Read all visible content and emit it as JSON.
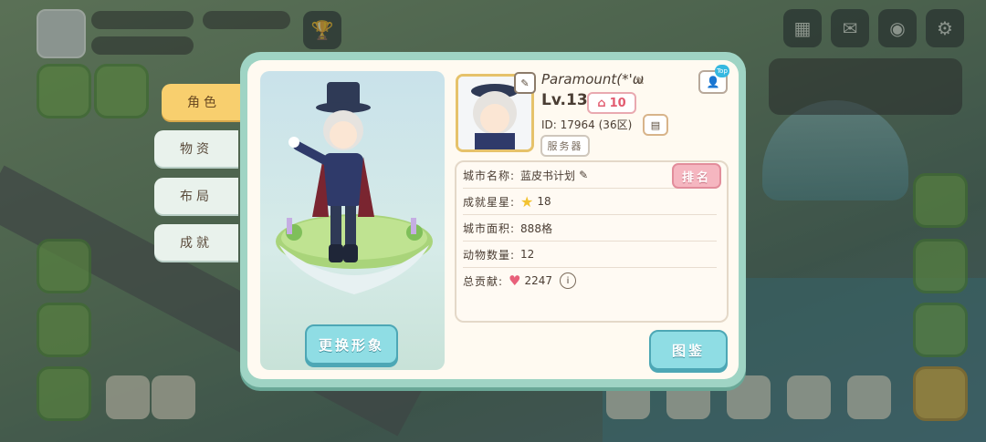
{
  "tabs": [
    {
      "label": "角色",
      "active": true
    },
    {
      "label": "物资",
      "active": false
    },
    {
      "label": "布局",
      "active": false
    },
    {
      "label": "成就",
      "active": false
    }
  ],
  "character": {
    "change_button": "更换形象"
  },
  "profile": {
    "name": "Paramount(*'ω",
    "level_prefix": "Lv.",
    "level": "13",
    "home_level": "10",
    "uid_text": "ID: 17964 (36区)",
    "server_button": "服务器",
    "top_badge": "Top"
  },
  "info_rows": [
    {
      "label": "城市名称:",
      "value": "蓝皮书计划",
      "icon": "pencil-icon"
    },
    {
      "label": "成就星星:",
      "value": "18",
      "icon": "star-icon"
    },
    {
      "label": "城市面积:",
      "value": "888格",
      "icon": ""
    },
    {
      "label": "动物数量:",
      "value": "12",
      "icon": ""
    },
    {
      "label": "总贡献:",
      "value": "2247",
      "icon": "heart-icon"
    }
  ],
  "buttons": {
    "rank": "排名",
    "atlas": "图鉴"
  },
  "colors": {
    "panel_border": "#9fd4c4",
    "active_tab": "#f8cf6e",
    "accent_button": "#8fdde4",
    "rank_button": "#f5b6c0",
    "level_badge": "#e25b70"
  }
}
